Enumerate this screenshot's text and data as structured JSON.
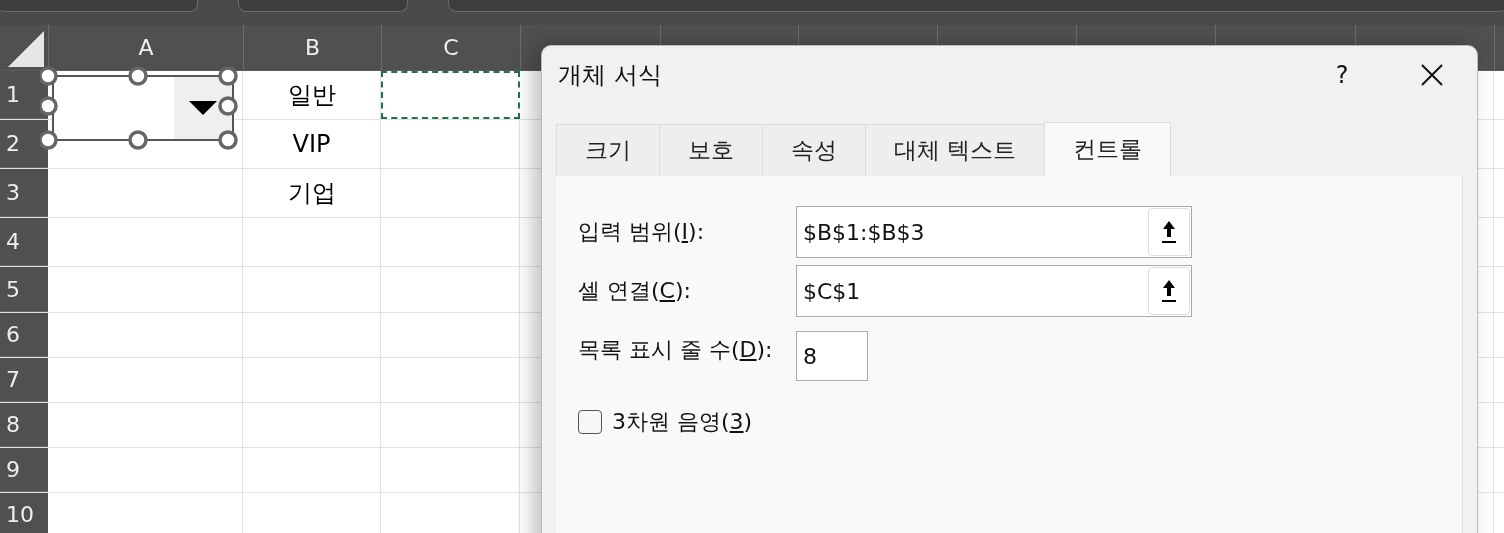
{
  "sheet": {
    "columns": [
      "A",
      "B",
      "C"
    ],
    "rows": [
      {
        "label": "1",
        "b": "일반",
        "c_marquee": true
      },
      {
        "label": "2",
        "b": "VIP",
        "c_marquee": false
      },
      {
        "label": "3",
        "b": "기업",
        "c_marquee": false
      },
      {
        "label": "4",
        "c_marquee": false
      },
      {
        "label": "5",
        "c_marquee": false
      },
      {
        "label": "6",
        "c_marquee": false
      },
      {
        "label": "7",
        "c_marquee": false
      },
      {
        "label": "8",
        "c_marquee": false
      },
      {
        "label": "9",
        "c_marquee": false
      },
      {
        "label": "10",
        "c_marquee": false
      }
    ]
  },
  "dialog": {
    "title": "개체 서식",
    "help": "?",
    "tabs": [
      {
        "label": "크기",
        "selected": false
      },
      {
        "label": "보호",
        "selected": false
      },
      {
        "label": "속성",
        "selected": false
      },
      {
        "label": "대체 텍스트",
        "selected": false
      },
      {
        "label": "컨트롤",
        "selected": true
      }
    ],
    "fields": [
      {
        "kind": "ref",
        "label_pre": "입력 범위(",
        "accel": "I",
        "label_post": "):",
        "value": "$B$1:$B$3"
      },
      {
        "kind": "ref",
        "label_pre": "셀 연결(",
        "accel": "C",
        "label_post": "):",
        "value": "$C$1"
      },
      {
        "kind": "number",
        "label_pre": "목록 표시 줄 수(",
        "accel": "D",
        "label_post": "):",
        "value": "8"
      }
    ],
    "checkbox": {
      "label_pre": "3차원 음영(",
      "accel": "3",
      "label_post": ")",
      "checked": false
    }
  }
}
